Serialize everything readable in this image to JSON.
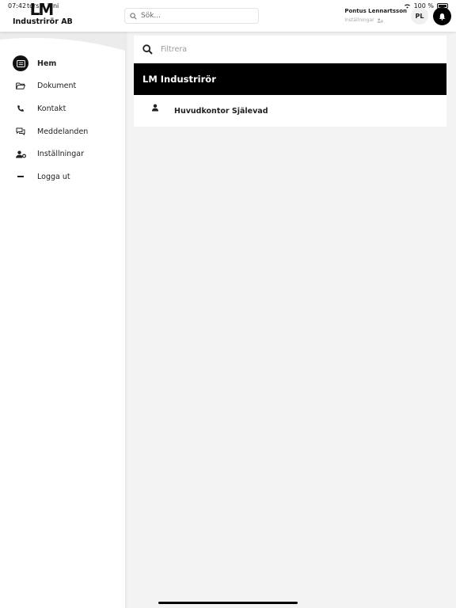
{
  "status_bar": {
    "time": "07:42",
    "date": "tors 4 juni",
    "battery": "100 %"
  },
  "header": {
    "logo_mark": "LM",
    "logo_name": "Industrirör AB",
    "search_placeholder": "Sök...",
    "user_name": "Pontus Lennartsson",
    "user_settings": "Inställningar",
    "avatar_initials": "PL"
  },
  "sidebar": {
    "items": [
      {
        "label": "Hem",
        "icon": "home-card-icon",
        "active": true
      },
      {
        "label": "Dokument",
        "icon": "folder-icon",
        "active": false
      },
      {
        "label": "Kontakt",
        "icon": "phone-icon",
        "active": false
      },
      {
        "label": "Meddelanden",
        "icon": "chat-icon",
        "active": false
      },
      {
        "label": "Inställningar",
        "icon": "user-gear-icon",
        "active": false
      },
      {
        "label": "Logga ut",
        "icon": "minus-icon",
        "active": false
      }
    ]
  },
  "main": {
    "filter_placeholder": "Filtrera",
    "group_title": "LM Industrirör",
    "rows": [
      {
        "label": "Huvudkontor Själevad",
        "icon": "person-icon"
      }
    ]
  },
  "colors": {
    "accent": "#000000",
    "background": "#f3f3f3",
    "panel": "#ffffff"
  }
}
